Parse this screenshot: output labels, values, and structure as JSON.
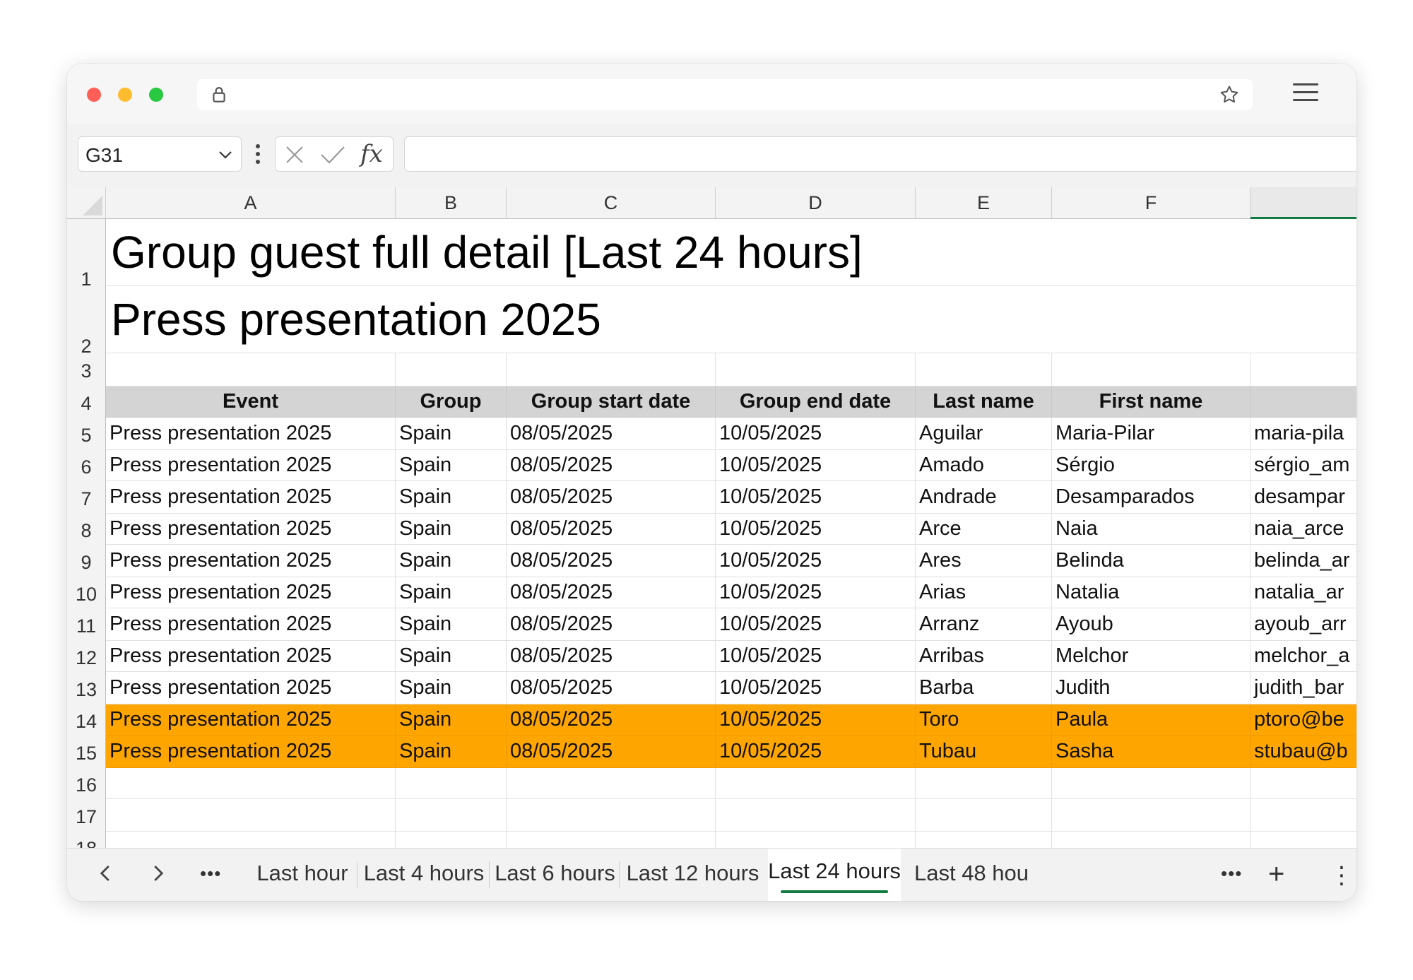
{
  "formula_bar": {
    "name_box": "G31",
    "fx_label": "fx"
  },
  "columns": [
    "A",
    "B",
    "C",
    "D",
    "E",
    "F",
    ""
  ],
  "rows": [
    "1",
    "2",
    "3",
    "4",
    "5",
    "6",
    "7",
    "8",
    "9",
    "10",
    "11",
    "12",
    "13",
    "14",
    "15",
    "16",
    "17",
    "18"
  ],
  "sheet": {
    "title": "Group guest full detail [Last 24 hours]",
    "subtitle": "Press presentation 2025",
    "headers": [
      "Event",
      "Group",
      "Group start date",
      "Group end date",
      "Last name",
      "First name",
      ""
    ],
    "data": [
      [
        "Press presentation 2025",
        "Spain",
        "08/05/2025",
        "10/05/2025",
        "Aguilar",
        "Maria-Pilar",
        "maria-pila"
      ],
      [
        "Press presentation 2025",
        "Spain",
        "08/05/2025",
        "10/05/2025",
        "Amado",
        "Sérgio",
        "sérgio_am"
      ],
      [
        "Press presentation 2025",
        "Spain",
        "08/05/2025",
        "10/05/2025",
        "Andrade",
        "Desamparados",
        "desampar"
      ],
      [
        "Press presentation 2025",
        "Spain",
        "08/05/2025",
        "10/05/2025",
        "Arce",
        "Naia",
        "naia_arce"
      ],
      [
        "Press presentation 2025",
        "Spain",
        "08/05/2025",
        "10/05/2025",
        "Ares",
        "Belinda",
        "belinda_ar"
      ],
      [
        "Press presentation 2025",
        "Spain",
        "08/05/2025",
        "10/05/2025",
        "Arias",
        "Natalia",
        "natalia_ar"
      ],
      [
        "Press presentation 2025",
        "Spain",
        "08/05/2025",
        "10/05/2025",
        "Arranz",
        "Ayoub",
        "ayoub_arr"
      ],
      [
        "Press presentation 2025",
        "Spain",
        "08/05/2025",
        "10/05/2025",
        "Arribas",
        "Melchor",
        "melchor_a"
      ],
      [
        "Press presentation 2025",
        "Spain",
        "08/05/2025",
        "10/05/2025",
        "Barba",
        "Judith",
        "judith_bar"
      ],
      [
        "Press presentation 2025",
        "Spain",
        "08/05/2025",
        "10/05/2025",
        "Toro",
        "Paula",
        "ptoro@be"
      ],
      [
        "Press presentation 2025",
        "Spain",
        "08/05/2025",
        "10/05/2025",
        "Tubau",
        "Sasha",
        "stubau@b"
      ]
    ],
    "highlighted_rows": [
      9,
      10
    ],
    "highlight_color": "#ffa500"
  },
  "tabs": {
    "items": [
      "Last hour",
      "Last 4 hours",
      "Last 6 hours",
      "Last 12 hours",
      "Last 24 hours",
      "Last 48 hou"
    ],
    "active_index": 4,
    "more_label": "•••",
    "add_label": "+",
    "menu_label": "⋮"
  },
  "colors": {
    "accent": "#107c41"
  }
}
